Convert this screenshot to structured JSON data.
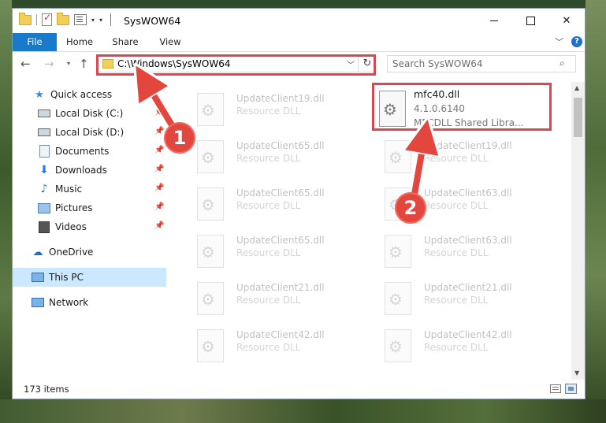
{
  "window": {
    "title": "SysWOW64"
  },
  "ribbon": {
    "tabs": [
      "File",
      "Home",
      "Share",
      "View"
    ],
    "help": "?"
  },
  "address": {
    "path": "C:\\Windows\\SysWOW64",
    "search_placeholder": "Search SysWOW64"
  },
  "nav": {
    "items": [
      {
        "label": "Quick access",
        "icon": "star-icon"
      },
      {
        "label": "Local Disk (C:)",
        "icon": "disk-icon"
      },
      {
        "label": "Local Disk (D:)",
        "icon": "disk-icon"
      },
      {
        "label": "Documents",
        "icon": "document-icon"
      },
      {
        "label": "Downloads",
        "icon": "download-icon"
      },
      {
        "label": "Music",
        "icon": "music-icon"
      },
      {
        "label": "Pictures",
        "icon": "pictures-icon"
      },
      {
        "label": "Videos",
        "icon": "video-icon"
      },
      {
        "label": "OneDrive",
        "icon": "cloud-icon"
      },
      {
        "label": "This PC",
        "icon": "pc-icon"
      },
      {
        "label": "Network",
        "icon": "network-icon"
      }
    ],
    "selected": "This PC"
  },
  "files": {
    "left_column": [
      {
        "name": "UpdateClient19.dll",
        "type": "Resource DLL"
      },
      {
        "name": "UpdateClient65.dll",
        "type": "Resource DLL"
      },
      {
        "name": "UpdateClient65.dll",
        "type": "Resource DLL"
      },
      {
        "name": "UpdateClient65.dll",
        "type": "Resource DLL"
      },
      {
        "name": "UpdateClient21.dll",
        "type": "Resource DLL"
      },
      {
        "name": "UpdateClient42.dll",
        "type": "Resource DLL"
      }
    ],
    "right_column": [
      {
        "name": "UpdateClient19.dll",
        "type": "Resource DLL"
      },
      {
        "name": "UpdateClient63.dll",
        "type": "Resource DLL"
      },
      {
        "name": "UpdateClient63.dll",
        "type": "Resource DLL"
      },
      {
        "name": "UpdateClient21.dll",
        "type": "Resource DLL"
      },
      {
        "name": "UpdateClient42.dll",
        "type": "Resource DLL"
      }
    ],
    "highlighted": {
      "name": "mfc40.dll",
      "version": "4.1.0.6140",
      "description": "MFCDLL Shared Libra..."
    }
  },
  "status": {
    "item_count": "173 items"
  },
  "annotations": {
    "badge_1": "1",
    "badge_2": "2",
    "color": "#d9484f"
  }
}
